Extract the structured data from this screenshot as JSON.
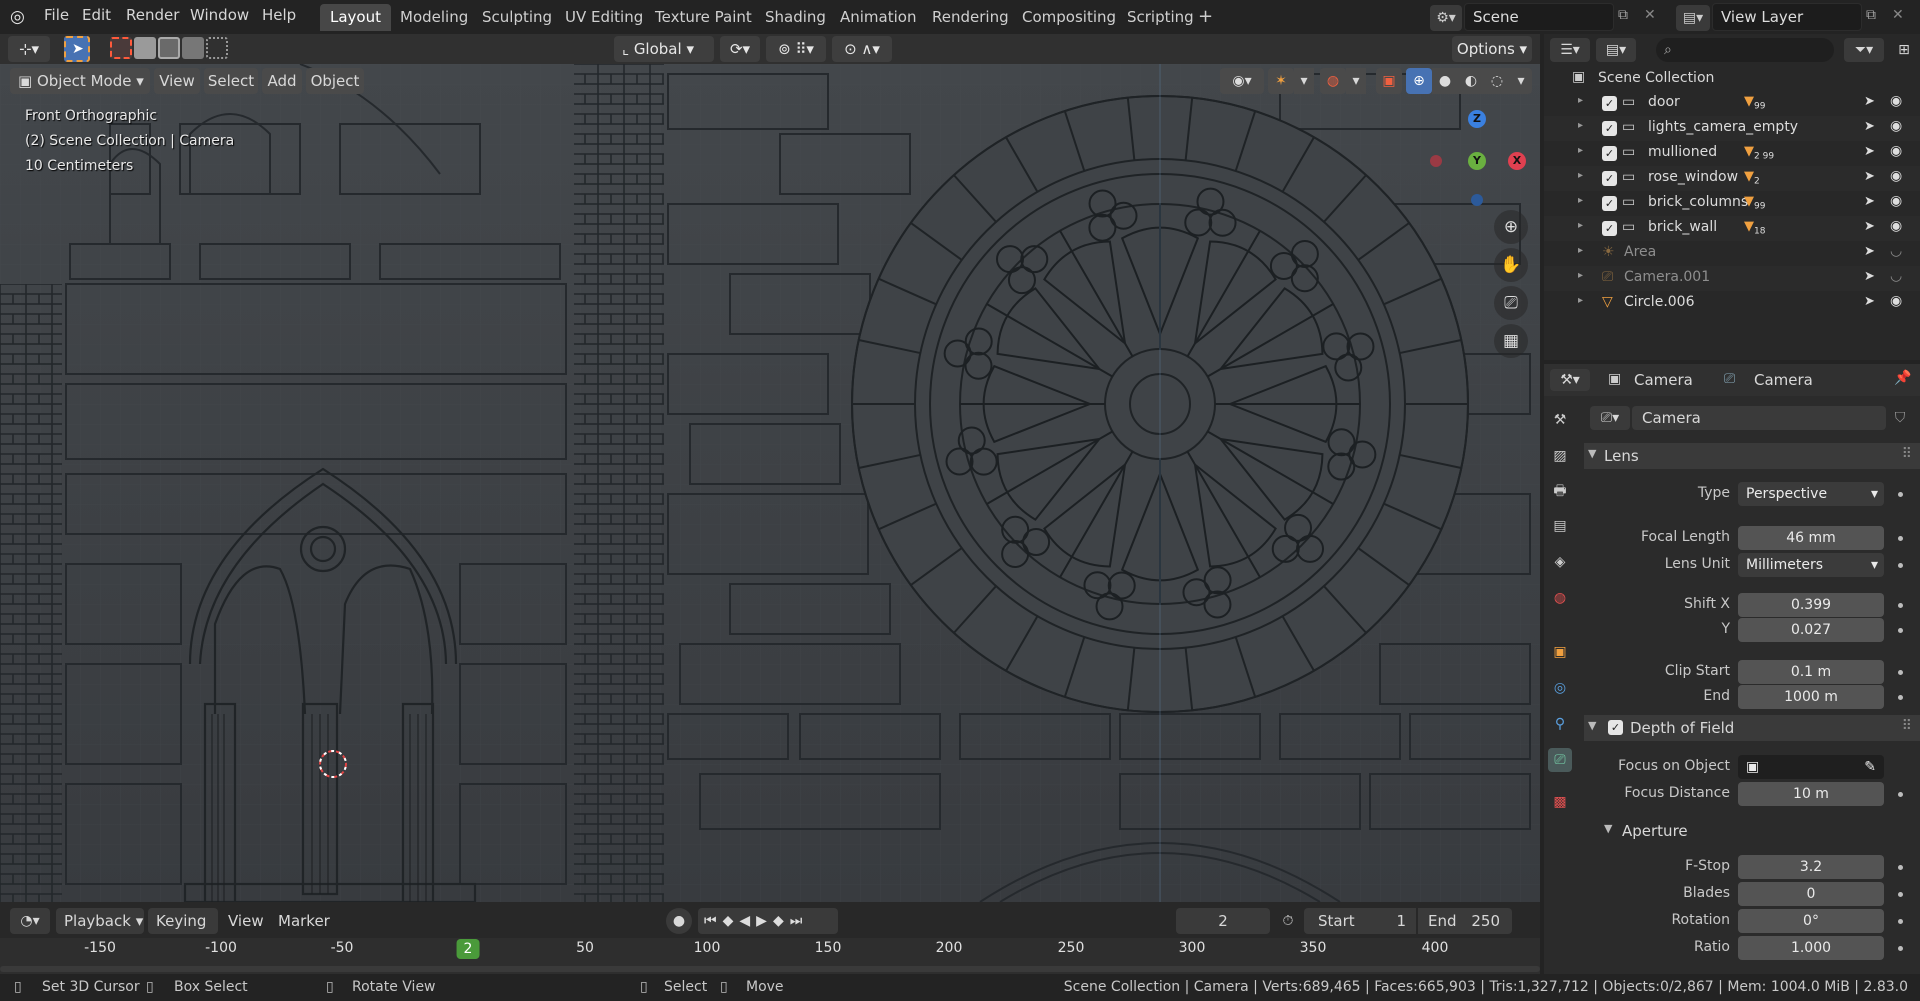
{
  "menu": [
    "File",
    "Edit",
    "Render",
    "Window",
    "Help"
  ],
  "workspaces": [
    "Layout",
    "Modeling",
    "Sculpting",
    "UV Editing",
    "Texture Paint",
    "Shading",
    "Animation",
    "Rendering",
    "Compositing",
    "Scripting"
  ],
  "active_workspace": "Layout",
  "scene": "Scene",
  "view_layer": "View Layer",
  "header": {
    "transform_orientation": "Global",
    "options": "Options",
    "mode": "Object Mode",
    "view": "View",
    "select": "Select",
    "add": "Add",
    "object": "Object"
  },
  "viewport": {
    "view_name": "Front Orthographic",
    "collection_info": "(2) Scene Collection | Camera",
    "scale": "10 Centimeters",
    "gizmo": {
      "x": "X",
      "y": "Y",
      "z": "Z"
    }
  },
  "outliner": {
    "root": "Scene Collection",
    "items": [
      {
        "name": "door",
        "badge": "99",
        "dim": false
      },
      {
        "name": "lights_camera_empty",
        "badge": "",
        "dim": false
      },
      {
        "name": "mullioned",
        "badge": "2 99",
        "dim": false
      },
      {
        "name": "rose_window",
        "badge": "2",
        "dim": false
      },
      {
        "name": "brick_columns",
        "badge": "99",
        "dim": false
      },
      {
        "name": "brick_wall",
        "badge": "18",
        "dim": false
      },
      {
        "name": "Area",
        "badge": "",
        "dim": true
      },
      {
        "name": "Camera.001",
        "badge": "",
        "dim": true
      },
      {
        "name": "Circle.006",
        "badge": "",
        "dim": false
      }
    ]
  },
  "properties": {
    "breadcrumb_object": "Camera",
    "breadcrumb_data": "Camera",
    "data_name": "Camera",
    "lens_panel": "Lens",
    "type_label": "Type",
    "type_value": "Perspective",
    "focal_length_label": "Focal Length",
    "focal_length": "46 mm",
    "lens_unit_label": "Lens Unit",
    "lens_unit": "Millimeters",
    "shift_x_label": "Shift X",
    "shift_x": "0.399",
    "shift_y_label": "Y",
    "shift_y": "0.027",
    "clip_start_label": "Clip Start",
    "clip_start": "0.1 m",
    "clip_end_label": "End",
    "clip_end": "1000 m",
    "dof_panel": "Depth of Field",
    "focus_object_label": "Focus on Object",
    "focus_distance_label": "Focus Distance",
    "focus_distance": "10 m",
    "aperture_panel": "Aperture",
    "fstop_label": "F-Stop",
    "fstop": "3.2",
    "blades_label": "Blades",
    "blades": "0",
    "rotation_label": "Rotation",
    "rotation": "0°",
    "ratio_label": "Ratio",
    "ratio": "1.000"
  },
  "timeline": {
    "playback": "Playback",
    "keying": "Keying",
    "view": "View",
    "marker": "Marker",
    "current_frame": "2",
    "start_label": "Start",
    "start": "1",
    "end_label": "End",
    "end": "250",
    "ticks": [
      "-150",
      "-100",
      "-50",
      "2",
      "50",
      "100",
      "150",
      "200",
      "250",
      "300",
      "350",
      "400"
    ]
  },
  "statusbar": {
    "set_cursor": "Set 3D Cursor",
    "box_select": "Box Select",
    "rotate_view": "Rotate View",
    "select": "Select",
    "move": "Move",
    "stats": "Scene Collection | Camera | Verts:689,465 | Faces:665,903 | Tris:1,327,712 | Objects:0/2,867 | Mem: 1004.0 MiB | 2.83.0"
  },
  "colors": {
    "accent": "#4772b3",
    "active_frame": "#4a9a3a",
    "object_orange": "#f0a040",
    "axis_x": "#e04050",
    "axis_y": "#6ab040",
    "axis_z": "#3a80e0"
  }
}
